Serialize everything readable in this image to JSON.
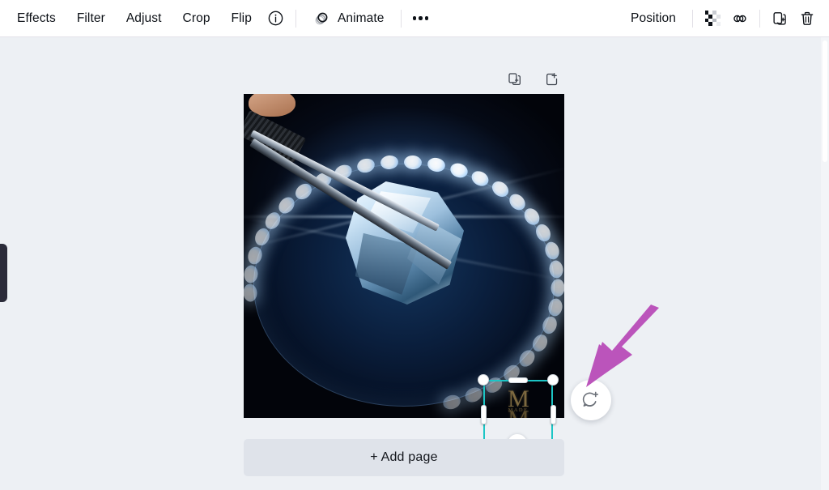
{
  "toolbar": {
    "left_items": [
      {
        "label": "Effects",
        "name": "effects-button"
      },
      {
        "label": "Filter",
        "name": "filter-button"
      },
      {
        "label": "Adjust",
        "name": "adjust-button"
      },
      {
        "label": "Crop",
        "name": "crop-button"
      },
      {
        "label": "Flip",
        "name": "flip-button"
      }
    ],
    "info_icon": "info-icon",
    "animate_label": "Animate",
    "animate_icon": "animate-icon",
    "more_icon": "more-options-icon",
    "position_label": "Position",
    "transparency_icon": "transparency-icon",
    "link_icon": "link-icon",
    "duplicate_icon": "duplicate-icon",
    "delete_icon": "trash-icon"
  },
  "page_actions": {
    "duplicate_page_icon": "duplicate-page-icon",
    "add_page_icon": "add-page-icon"
  },
  "canvas": {
    "add_page_label": "+ Add page",
    "rotate_icon": "rotate-icon",
    "comment_icon": "add-comment-icon",
    "selected_element": {
      "logo_top": "M",
      "logo_sub": "MADE",
      "logo_bottom": "M"
    }
  },
  "colors": {
    "toolbar_bg": "#ffffff",
    "canvas_bg": "#edf0f4",
    "selection": "#1cc5c5",
    "annotation_arrow": "#bb54bb",
    "add_page_bg": "#dfe3ea",
    "text": "#0d1117"
  }
}
